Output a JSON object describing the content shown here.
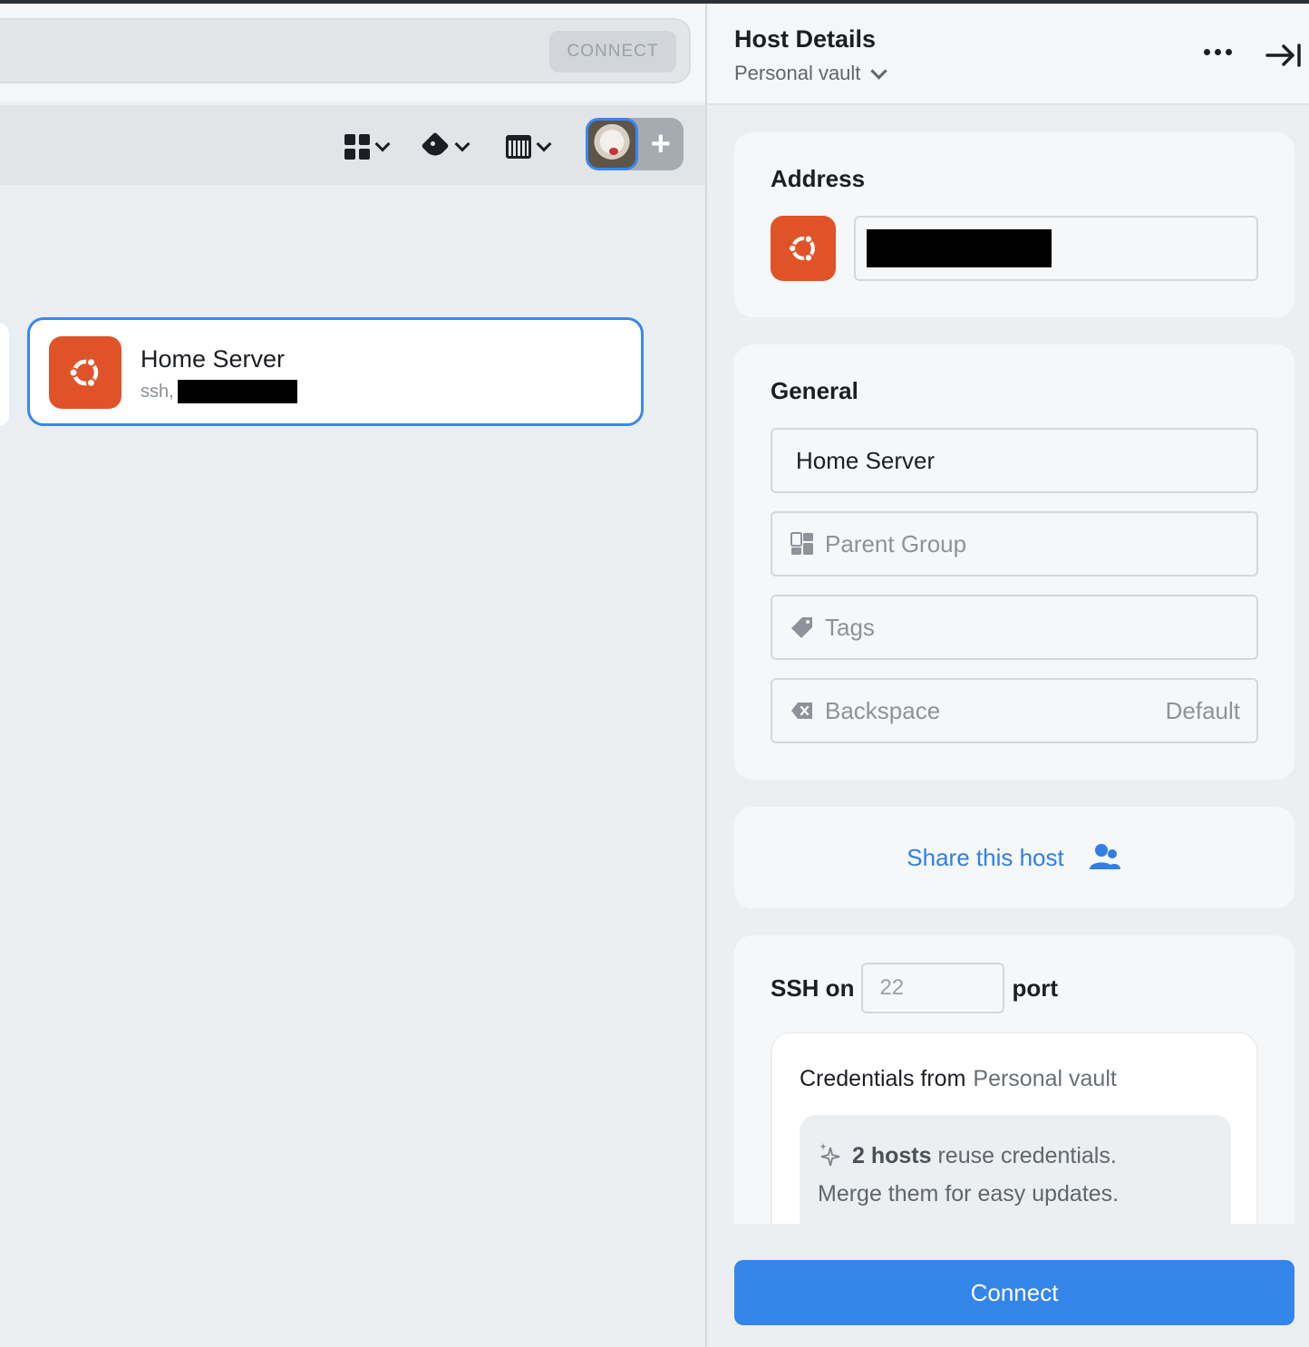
{
  "toolbar_top": {
    "connect_label": "CONNECT"
  },
  "toolbar": {
    "layout_icon": "grid-icon",
    "tag_icon": "tag-icon",
    "calendar_icon": "calendar-icon",
    "add_icon": "plus-icon"
  },
  "host_card": {
    "name": "Home Server",
    "subtitle_prefix": "ssh,"
  },
  "details": {
    "title": "Host Details",
    "vault": "Personal vault",
    "address": {
      "title": "Address"
    },
    "general": {
      "title": "General",
      "label_value": "Home Server",
      "parent_group_placeholder": "Parent Group",
      "tags_placeholder": "Tags",
      "backspace_label": "Backspace",
      "backspace_value": "Default"
    },
    "share_label": "Share this host",
    "ssh": {
      "prefix": "SSH on",
      "port": "22",
      "suffix": "port"
    },
    "credentials": {
      "title": "Credentials from",
      "source": "Personal vault",
      "tip_bold": "2 hosts",
      "tip_rest": "reuse credentials.",
      "tip_line2": "Merge them for easy updates."
    },
    "connect_label": "Connect"
  },
  "colors": {
    "accent": "#3485ea",
    "ubuntu": "#e05328",
    "selection": "#3a86f0"
  }
}
